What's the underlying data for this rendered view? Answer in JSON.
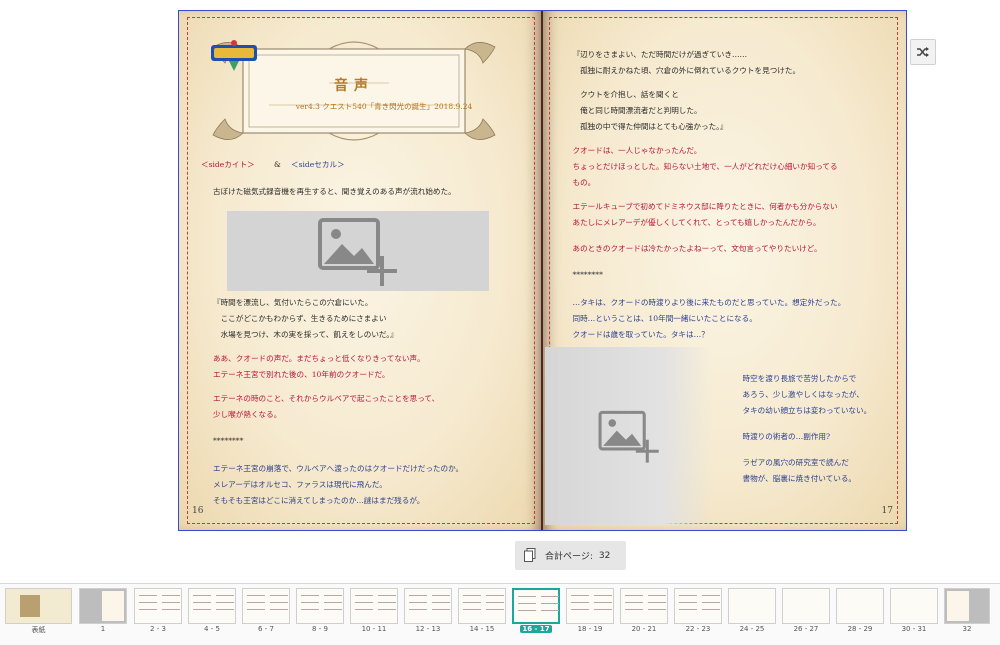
{
  "book": {
    "left_page": {
      "title": "音声",
      "subtitle": "ver4.3 クエスト540「青き閃光の誕生」2018.9.24",
      "side_label_left": "＜sideカイト＞",
      "side_amp": "&",
      "side_label_right": "＜sideセカル＞",
      "intro": "古ぼけた磁気式録音機を再生すると、聞き覚えのある声が流れ始めた。",
      "quote_lines": [
        "『時間を漂流し、気付いたらこの穴倉にいた。",
        "　ここがどこかもわからず、生きるためにさまよい",
        "　水場を見つけ、木の実を採って、飢えをしのいだ。』"
      ],
      "red_lines_1": [
        "ああ、クオードの声だ。まだちょっと低くなりきってない声。",
        "エテーネ王宮で別れた後の、10年前のクオードだ。"
      ],
      "red_lines_2": [
        "エテーネの時のこと、それからウルベアで起こったことを思って、",
        "少し喉が熱くなる。"
      ],
      "separator": "********",
      "last_lines": [
        "エテーネ王宮の崩落で、ウルベアへ渡ったのはクオードだけだったのか。",
        "メレアーデはオルセコ、ファラスは現代に飛んだ。",
        "そもそも王宮はどこに消えてしまったのか…謎はまだ残るが。"
      ],
      "page_number": "16"
    },
    "right_page": {
      "quote_lines": [
        "『辺りをさまよい、ただ時間だけが過ぎていき……",
        "　孤独に耐えかねた頃、穴倉の外に倒れているクウトを見つけた。",
        "",
        "　クウトを介抱し、話を聞くと",
        "　俺と同じ時間漂流者だと判明した。",
        "　孤独の中で得た仲間はとても心強かった。』"
      ],
      "red_lines_1": [
        "クオードは、一人じゃなかったんだ。",
        "ちょっとだけほっとした。知らない土地で、一人がどれだけ心細いか知ってる",
        "もの。"
      ],
      "red_lines_2": [
        "エテールキューブで初めてドミネウス邸に降りたときに、何者かも分からない",
        "あたしにメレアーデが優しくしてくれて、とっても嬉しかったんだから。"
      ],
      "red_lines_3": [
        "あのときのクオードは冷たかったよねーって、文句言ってやりたいけど。"
      ],
      "separator": "********",
      "blue_lines": [
        "…タキは、クオードの時渡りより後に来たものだと思っていた。想定外だった。",
        "同時…ということは、10年間一緒にいたことになる。",
        "クオードは歳を取っていた。タキは…？"
      ],
      "side_blue_1": [
        "時空を渡り長旅で苦労したからで",
        "あろう、少し激やしくはなったが、",
        "タキの幼い顔立ちは変わっていない。"
      ],
      "side_blue_2": [
        "時渡りの術者の…副作用?"
      ],
      "side_blue_3": [
        "ラゼアの風穴の研究室で読んだ",
        "書物が、脳裏に焼き付いている。"
      ],
      "page_number": "17"
    }
  },
  "shuffle_icon": "shuffle-icon",
  "page_count": {
    "label": "合計ページ:",
    "value": "32"
  },
  "thumbnails": [
    {
      "label": "表紙"
    },
    {
      "label": "1"
    },
    {
      "label": "2 - 3"
    },
    {
      "label": "4 - 5"
    },
    {
      "label": "6 - 7"
    },
    {
      "label": "8 - 9"
    },
    {
      "label": "10 - 11"
    },
    {
      "label": "12 - 13"
    },
    {
      "label": "14 - 15"
    },
    {
      "label": "16 - 17"
    },
    {
      "label": "18 - 19"
    },
    {
      "label": "20 - 21"
    },
    {
      "label": "22 - 23"
    },
    {
      "label": "24 - 25"
    },
    {
      "label": "26 - 27"
    },
    {
      "label": "28 - 29"
    },
    {
      "label": "30 - 31"
    },
    {
      "label": "32"
    }
  ],
  "selected_thumbnail": "16 - 17",
  "colors": {
    "accent": "#1aa89a",
    "red_text": "#b8153a",
    "blue_text": "#2a3f8e",
    "page_border": "#3a4ad0"
  }
}
